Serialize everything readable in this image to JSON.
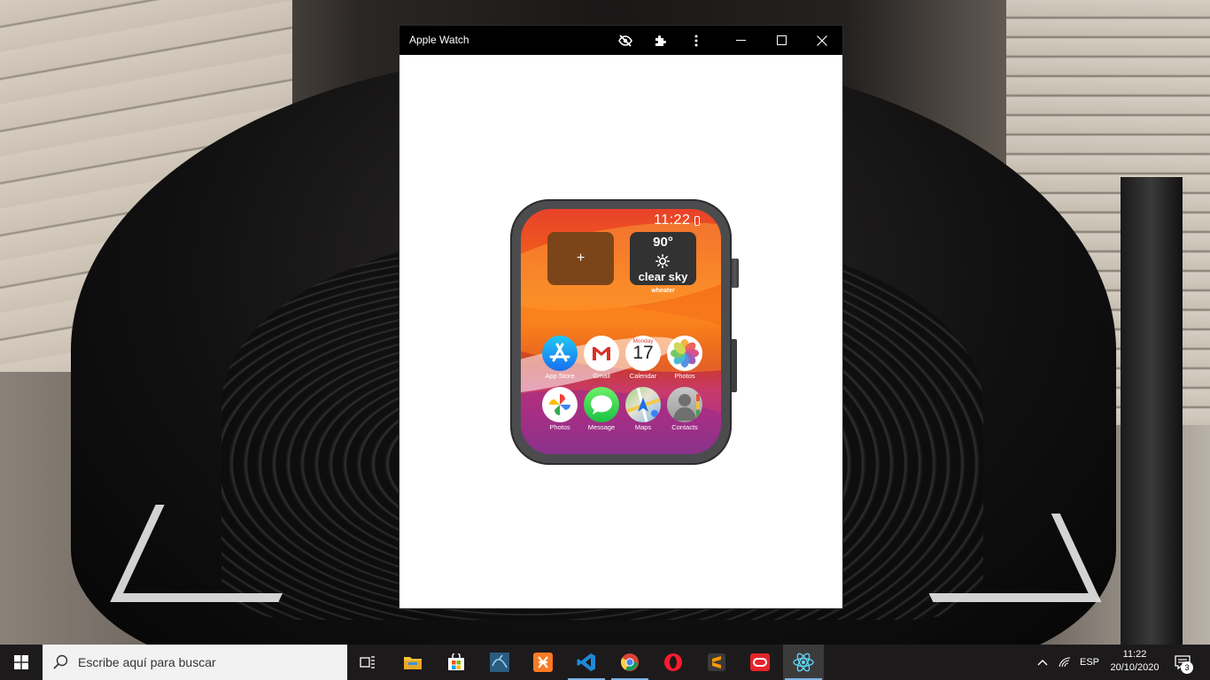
{
  "window": {
    "title": "Apple Watch",
    "toolbar_icons": [
      "eye-off-icon",
      "puzzle-icon",
      "more-vert-icon"
    ],
    "controls": [
      "minimize-icon",
      "maximize-icon",
      "close-icon"
    ]
  },
  "watch": {
    "time": "11:22",
    "battery_color": "#ff3b30",
    "add_widget": {
      "label": "+",
      "color": "#7c4519"
    },
    "weather": {
      "temperature": "90°",
      "icon": "sun-icon",
      "description": "clear sky",
      "caption": "wheater"
    },
    "apps_row1": [
      {
        "label": "App Store",
        "icon": "app-store-icon"
      },
      {
        "label": "Gmail",
        "icon": "gmail-icon"
      },
      {
        "label": "Calendar",
        "icon": "calendar-icon",
        "day_name": "Monday",
        "day_number": "17"
      },
      {
        "label": "Photos",
        "icon": "photos-icon"
      }
    ],
    "apps_row2": [
      {
        "label": "Photos",
        "icon": "google-photos-icon"
      },
      {
        "label": "Message",
        "icon": "message-icon"
      },
      {
        "label": "Maps",
        "icon": "maps-icon"
      },
      {
        "label": "Contacts",
        "icon": "contacts-icon"
      }
    ]
  },
  "taskbar": {
    "search_placeholder": "Escribe aquí para buscar",
    "pinned": [
      "task-view-icon",
      "file-explorer-icon",
      "store-icon",
      "mysql-workbench-icon",
      "xampp-icon",
      "vscode-icon",
      "chrome-icon",
      "opera-icon",
      "sublime-text-icon",
      "oracle-icon",
      "react-electron-icon"
    ],
    "language": "ESP",
    "time": "11:22",
    "date": "20/10/2020",
    "notifications": "3"
  }
}
